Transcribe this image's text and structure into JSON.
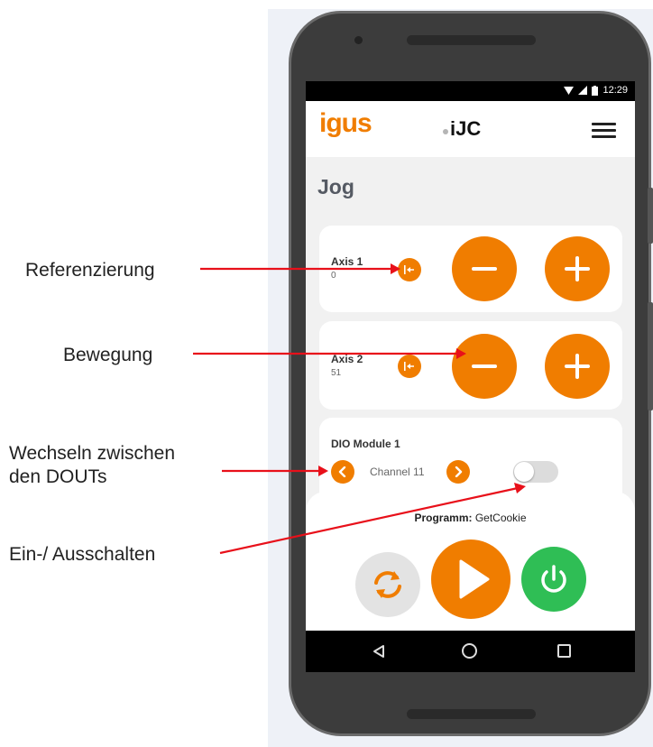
{
  "annotations": {
    "referenzierung": "Referenzierung",
    "bewegung": "Bewegung",
    "wechseln_line1": "Wechseln zwischen",
    "wechseln_line2": "den DOUTs",
    "ein_aus": "Ein-/ Ausschalten"
  },
  "statusbar": {
    "time": "12:29"
  },
  "appbar": {
    "brand": "igus",
    "app_name": "iJC",
    "menu_icon": "hamburger-menu-icon"
  },
  "page": {
    "title": "Jog"
  },
  "axes": [
    {
      "name": "Axis 1",
      "value": "0"
    },
    {
      "name": "Axis 2",
      "value": "51"
    }
  ],
  "dio": {
    "title": "DIO Module 1",
    "channel": "Channel 11",
    "output_on": false
  },
  "program": {
    "label": "Programm:",
    "name": "GetCookie"
  },
  "colors": {
    "accent": "#f07d00",
    "power": "#2fbe55",
    "arrow": "#e8101a"
  }
}
